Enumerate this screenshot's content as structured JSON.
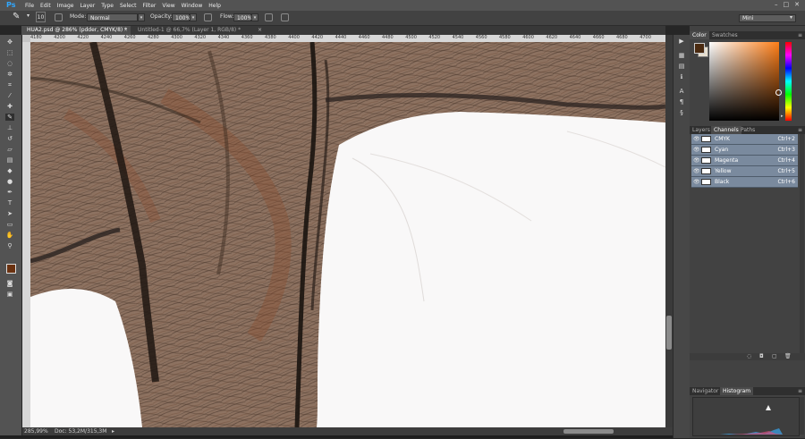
{
  "app": {
    "logo": "Ps",
    "workspace": "Mini"
  },
  "menu": [
    "File",
    "Edit",
    "Image",
    "Layer",
    "Type",
    "Select",
    "Filter",
    "View",
    "Window",
    "Help"
  ],
  "window_controls": [
    "–",
    "□",
    "✕"
  ],
  "options_bar": {
    "brush_size": "10",
    "mode_label": "Mode:",
    "mode_value": "Normal",
    "opacity_label": "Opacity:",
    "opacity_value": "100%",
    "flow_label": "Flow:",
    "flow_value": "100%"
  },
  "tabs": [
    {
      "label": "HUA2.psd @ 286% (pdder, CMYK/8) *",
      "close": "×"
    },
    {
      "label": "Untitled-1 @ 66,7% (Layer 1, RGB/8) *",
      "close": "×"
    }
  ],
  "ruler_ticks": [
    "4180",
    "4200",
    "4220",
    "4240",
    "4260",
    "4280",
    "4300",
    "4320",
    "4340",
    "4360",
    "4380",
    "4400",
    "4420",
    "4440",
    "4460",
    "4480",
    "4500",
    "4520",
    "4540",
    "4560",
    "4580",
    "4600",
    "4620",
    "4640",
    "4660",
    "4680",
    "4700"
  ],
  "status": {
    "zoom": "285,99%",
    "doc": "Doc: 53,2M/315,3M"
  },
  "color_panel": {
    "tabs": [
      "Color",
      "Swatches"
    ],
    "fg": "#4a2a10",
    "bg": "#e8e0d0"
  },
  "channels_panel": {
    "tabs": [
      "Layers",
      "Channels",
      "Paths"
    ],
    "channels": [
      {
        "name": "CMYK",
        "shortcut": "Ctrl+2"
      },
      {
        "name": "Cyan",
        "shortcut": "Ctrl+3"
      },
      {
        "name": "Magenta",
        "shortcut": "Ctrl+4"
      },
      {
        "name": "Yellow",
        "shortcut": "Ctrl+5"
      },
      {
        "name": "Black",
        "shortcut": "Ctrl+6"
      }
    ]
  },
  "histogram_panel": {
    "tabs": [
      "Navigator",
      "Histogram"
    ]
  },
  "colors": {
    "accent": "#31a8ff",
    "panel_bg": "#424242",
    "selected_row": "#7a8a9e",
    "hair": "#5a4030"
  }
}
